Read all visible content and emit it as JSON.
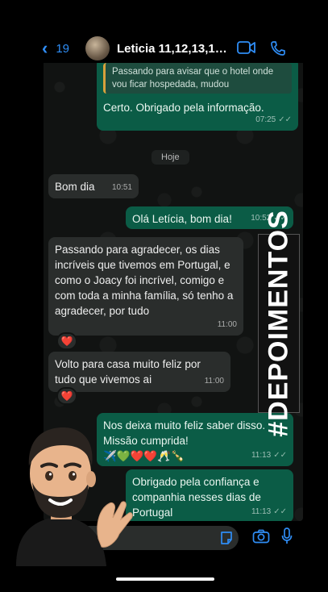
{
  "header": {
    "back_count": "19",
    "contact_name": "Leticia 11,12,13,14..."
  },
  "messages": {
    "quoted_reply": "Passando para avisar que o hotel onde vou ficar hospedada, mudou",
    "m1_text": "Certo. Obrigado pela informação.",
    "m1_time": "07:25",
    "day_label": "Hoje",
    "m2_text": "Bom dia",
    "m2_time": "10:51",
    "m3_text": "Olá Letícia, bom dia!",
    "m3_time": "10:52",
    "m4_text": "Passando para agradecer, os dias incríveis que tivemos em Portugal, e como o Joacy foi incrível, comigo e com toda a minha família, só tenho a agradecer, por tudo",
    "m4_time": "11:00",
    "m5_text": "Volto para casa muito feliz por tudo que vivemos ai",
    "m5_time": "11:00",
    "m6_text": "Nos deixa muito feliz saber disso. Missão cumprida!",
    "m6_emojis": "✈️💚❤️❤️🥂🍾",
    "m6_time": "11:13",
    "m7_text": "Obrigado pela confiança e companhia nesses dias de Portugal",
    "m7_time": "11:13",
    "reaction": "❤️"
  },
  "overlay": {
    "hashtag": "#DEPOIMENTOS"
  },
  "colors": {
    "accent_blue": "#2f8df5",
    "outgoing_bubble": "#0b5c46",
    "incoming_bubble": "#2a2d2c"
  },
  "icons": [
    "chevron-left-icon",
    "video-call-icon",
    "phone-icon",
    "sticker-icon",
    "camera-icon",
    "microphone-icon",
    "plus-icon",
    "read-ticks-icon"
  ]
}
